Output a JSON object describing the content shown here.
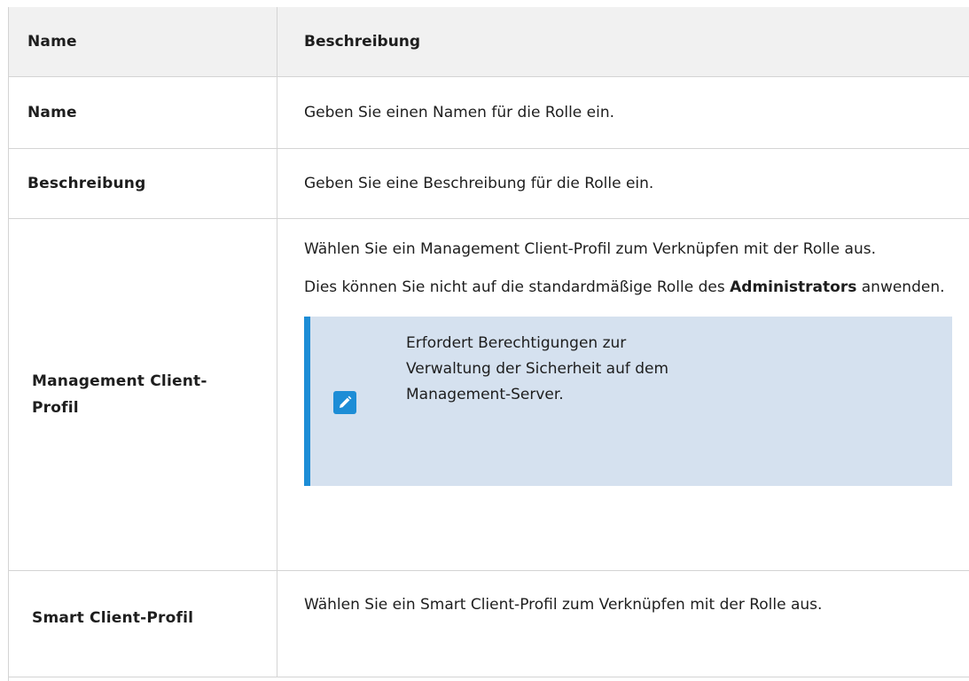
{
  "table": {
    "header": {
      "name": "Name",
      "description": "Beschreibung"
    },
    "rows": [
      {
        "name": "Name",
        "description": "Geben Sie einen Namen für die Rolle ein."
      },
      {
        "name": "Beschreibung",
        "description": "Geben Sie eine Beschreibung für die Rolle ein."
      },
      {
        "name": "Management Client-Profil",
        "description_p1": "Wählen Sie ein Management Client-Profil zum Verknüpfen mit der Rolle aus.",
        "description_p2_prefix": "Dies können Sie nicht auf die standardmäßige Rolle des ",
        "description_p2_bold": "Administrators",
        "description_p2_suffix": " anwenden.",
        "note": {
          "icon": "edit-note-icon",
          "text": "Erfordert Berechtigungen zur Verwaltung der Sicherheit auf dem Management-Server."
        }
      },
      {
        "name": "Smart Client-Profil",
        "description": "Wählen Sie ein Smart Client-Profil zum Verknüpfen mit der Rolle aus."
      }
    ]
  },
  "colors": {
    "note_background": "#d5e1ef",
    "note_accent": "#1d8dd6",
    "header_background": "#f1f1f1"
  }
}
